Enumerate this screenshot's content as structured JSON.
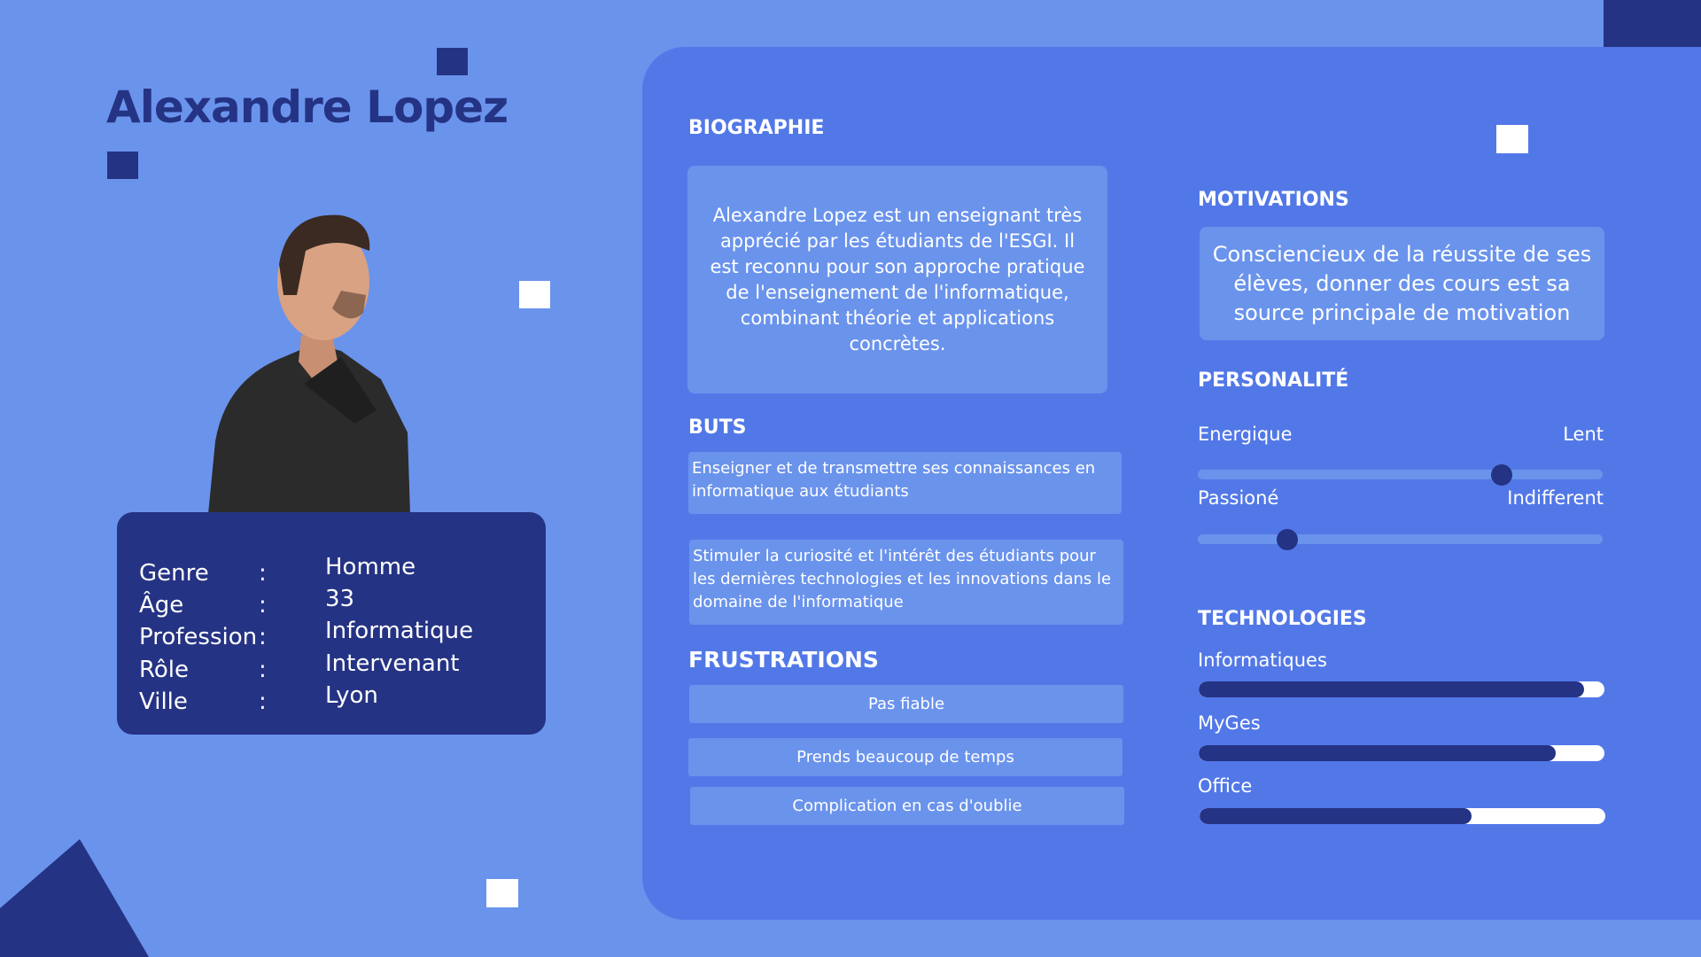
{
  "colors": {
    "background": "#6a93ec",
    "panel": "#5278e8",
    "dark": "#253384",
    "box": "#6a93ec",
    "white": "#ffffff"
  },
  "profile": {
    "name": "Alexandre Lopez",
    "photo_icon": "person-portrait",
    "info": [
      {
        "label": "Genre",
        "value": "Homme"
      },
      {
        "label": "Âge",
        "value": "33"
      },
      {
        "label": "Profession",
        "value": "Informatique"
      },
      {
        "label": "Rôle",
        "value": "Intervenant"
      },
      {
        "label": "Ville",
        "value": "Lyon"
      }
    ],
    "separator": ":"
  },
  "biography": {
    "title": "BIOGRAPHIE",
    "text": "Alexandre Lopez  est un enseignant très apprécié par les étudiants de l'ESGI. Il est reconnu pour son approche pratique de l'enseignement de l'informatique, combinant théorie et applications concrètes."
  },
  "goals": {
    "title": "BUTS",
    "items": [
      "Enseigner et de transmettre ses connaissances en informatique aux étudiants",
      "Stimuler la curiosité et l'intérêt des étudiants pour les dernières technologies et les innovations dans le domaine de l'informatique"
    ]
  },
  "frustrations": {
    "title": "FRUSTRATIONS",
    "items": [
      "Pas fiable",
      "Prends beaucoup de temps",
      "Complication en cas d'oublie"
    ]
  },
  "motivations": {
    "title": "MOTIVATIONS",
    "text": "Consciencieux de la réussite de ses élèves, donner des cours est sa source principale de motivation"
  },
  "personality": {
    "title": "PERSONALITÉ",
    "traits": [
      {
        "left": "Energique",
        "right": "Lent",
        "value": 0.75
      },
      {
        "left": "Passioné",
        "right": "Indifferent",
        "value": 0.22
      }
    ]
  },
  "technologies": {
    "title": "TECHNOLOGIES",
    "items": [
      {
        "label": "Informatiques",
        "level": 0.95
      },
      {
        "label": "MyGes",
        "level": 0.88
      },
      {
        "label": "Office",
        "level": 0.67
      }
    ]
  }
}
